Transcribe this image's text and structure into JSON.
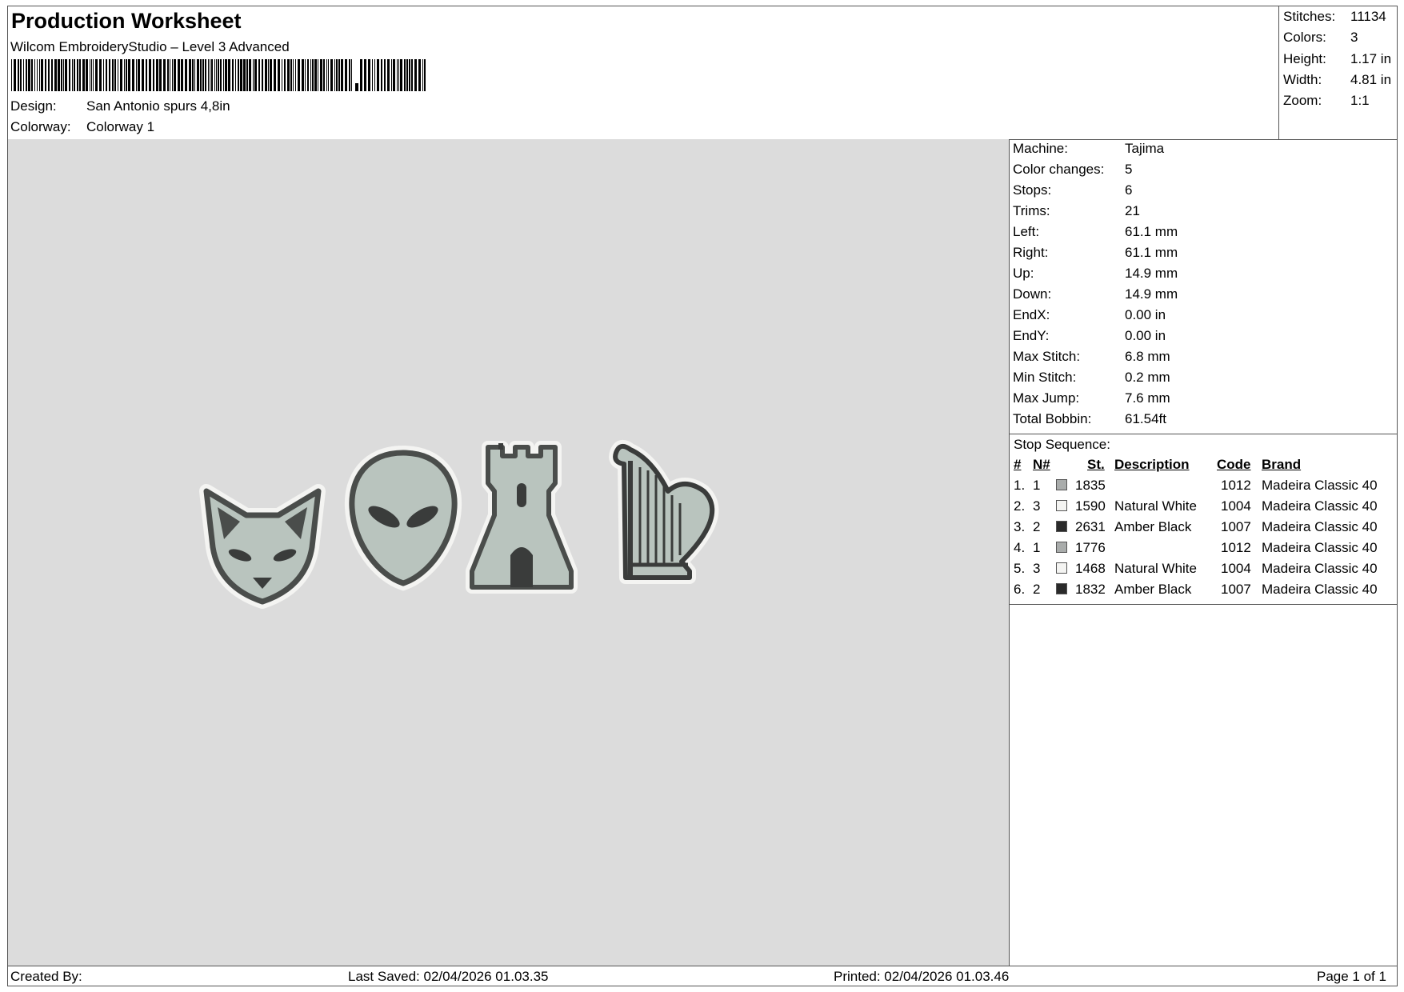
{
  "header": {
    "title": "Production Worksheet",
    "software": "Wilcom EmbroideryStudio – Level 3 Advanced",
    "design_label": "Design:",
    "design_value": "San Antonio spurs 4,8in",
    "colorway_label": "Colorway:",
    "colorway_value": "Colorway 1"
  },
  "stats": [
    {
      "label": "Stitches:",
      "value": "11134"
    },
    {
      "label": "Colors:",
      "value": "3"
    },
    {
      "label": "Height:",
      "value": "1.17 in"
    },
    {
      "label": "Width:",
      "value": "4.81 in"
    },
    {
      "label": "Zoom:",
      "value": "1:1"
    }
  ],
  "machine_info": [
    {
      "label": "Machine:",
      "value": "Tajima"
    },
    {
      "label": "Color changes:",
      "value": "5"
    },
    {
      "label": "Stops:",
      "value": "6"
    },
    {
      "label": "Trims:",
      "value": "21"
    },
    {
      "label": "Left:",
      "value": "61.1 mm"
    },
    {
      "label": "Right:",
      "value": "61.1 mm"
    },
    {
      "label": "Up:",
      "value": "14.9 mm"
    },
    {
      "label": "Down:",
      "value": "14.9 mm"
    },
    {
      "label": "EndX:",
      "value": "0.00 in"
    },
    {
      "label": "EndY:",
      "value": "0.00 in"
    },
    {
      "label": "Max Stitch:",
      "value": "6.8 mm"
    },
    {
      "label": "Min Stitch:",
      "value": "0.2 mm"
    },
    {
      "label": "Max Jump:",
      "value": "7.6 mm"
    },
    {
      "label": "Total Bobbin:",
      "value": "61.54ft"
    }
  ],
  "stop_sequence": {
    "title": "Stop Sequence:",
    "columns": [
      "#",
      "N#",
      "St.",
      "Description",
      "Code",
      "Brand"
    ],
    "rows": [
      {
        "num": "1.",
        "n": "1",
        "st": "1835",
        "desc": "",
        "code": "1012",
        "brand": "Madeira Classic 40",
        "color": "#a9acab"
      },
      {
        "num": "2.",
        "n": "3",
        "st": "1590",
        "desc": "Natural White",
        "code": "1004",
        "brand": "Madeira Classic 40",
        "color": "#f4f4f2"
      },
      {
        "num": "3.",
        "n": "2",
        "st": "2631",
        "desc": "Amber Black",
        "code": "1007",
        "brand": "Madeira Classic 40",
        "color": "#2a2a2a"
      },
      {
        "num": "4.",
        "n": "1",
        "st": "1776",
        "desc": "",
        "code": "1012",
        "brand": "Madeira Classic 40",
        "color": "#a9acab"
      },
      {
        "num": "5.",
        "n": "3",
        "st": "1468",
        "desc": "Natural White",
        "code": "1004",
        "brand": "Madeira Classic 40",
        "color": "#f4f4f2"
      },
      {
        "num": "6.",
        "n": "2",
        "st": "1832",
        "desc": "Amber Black",
        "code": "1007",
        "brand": "Madeira Classic 40",
        "color": "#2a2a2a"
      }
    ]
  },
  "footer": {
    "created_by": "Created By:",
    "last_saved": "Last Saved: 02/04/2026 01.03.35",
    "printed": "Printed: 02/04/2026 01.03.46",
    "page": "Page 1 of 1"
  },
  "colors": {
    "fill": "#b9c4be",
    "outline": "#4a4d4b",
    "border": "#f4f4f2",
    "background": "#dcdcdc"
  },
  "icons": [
    "fox-head-icon",
    "alien-head-icon",
    "castle-tower-icon",
    "harp-icon"
  ]
}
